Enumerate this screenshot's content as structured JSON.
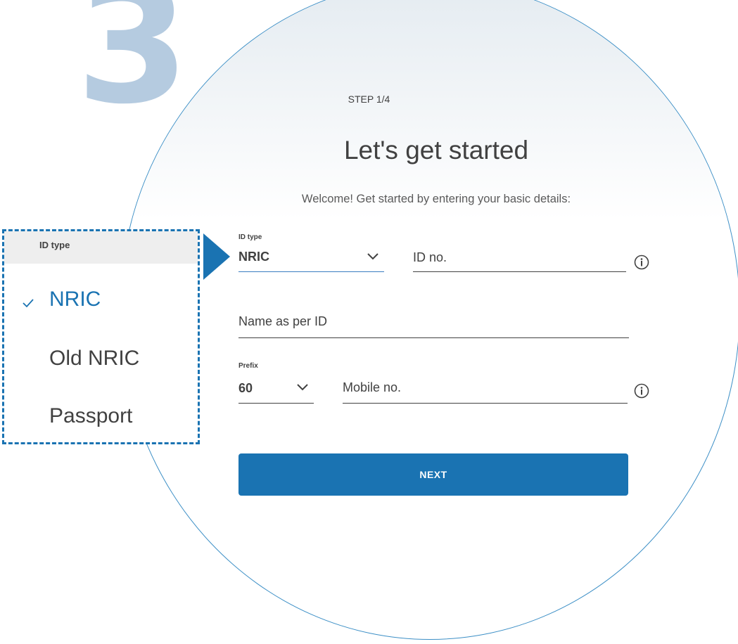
{
  "step_number": "3",
  "header": {
    "step_label": "STEP 1/4",
    "title": "Let's get started",
    "subtitle": "Welcome! Get started by entering your basic details:"
  },
  "form": {
    "id_type": {
      "label": "ID type",
      "value": "NRIC"
    },
    "id_no": {
      "placeholder": "ID no."
    },
    "name": {
      "placeholder": "Name as per ID"
    },
    "prefix": {
      "label": "Prefix",
      "value": "60"
    },
    "mobile": {
      "placeholder": "Mobile no."
    },
    "next_label": "NEXT"
  },
  "dropdown": {
    "header": "ID type",
    "options": [
      "NRIC",
      "Old NRIC",
      "Passport"
    ],
    "selected": "NRIC"
  },
  "icons": {
    "chevron": "chevron-down-icon",
    "info": "info-icon",
    "check": "check-icon"
  },
  "colors": {
    "accent": "#1a73b2",
    "step_number": "#b5cbe0",
    "text": "#414141"
  }
}
